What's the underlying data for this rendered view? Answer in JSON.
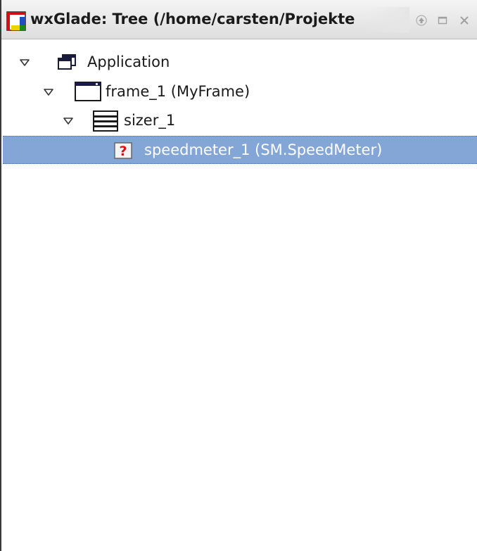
{
  "window": {
    "title": "wxGlade: Tree (/home/carsten/Projekte"
  },
  "tree": {
    "nodes": [
      {
        "label": "Application",
        "icon": "application-icon",
        "expanded": true
      },
      {
        "label": "frame_1 (MyFrame)",
        "icon": "frame-icon",
        "expanded": true
      },
      {
        "label": "sizer_1",
        "icon": "sizer-icon",
        "expanded": true
      },
      {
        "label": "speedmeter_1 (SM.SpeedMeter)",
        "icon": "unknown-widget-icon",
        "selected": true
      }
    ]
  },
  "colors": {
    "selection": "#84a6d6",
    "selection_text": "#ffffff"
  }
}
